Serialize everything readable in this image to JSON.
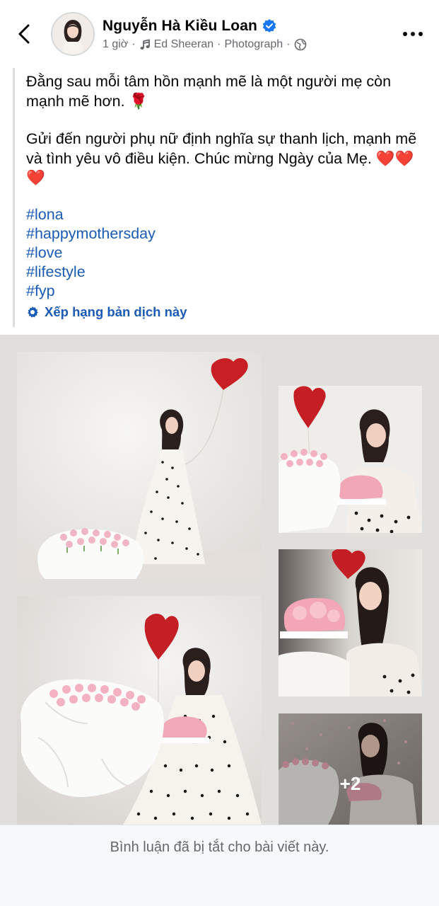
{
  "header": {
    "name": "Nguyễn Hà Kiều Loan",
    "time": "1 giờ",
    "music": "Ed Sheeran",
    "tag": "Photograph",
    "privacy": "Public",
    "icons": {
      "back": "chevron-left-icon",
      "verified": "verified-badge-icon",
      "music": "music-note-icon",
      "privacy": "globe-icon",
      "more": "more-dots-icon"
    },
    "colors": {
      "verified": "#1877f2",
      "meta": "#65676b"
    }
  },
  "post": {
    "line1": "Đằng sau mỗi tâm hồn mạnh mẽ là một người mẹ còn mạnh mẽ hơn. 🌹",
    "line2": "Gửi đến người phụ nữ định nghĩa sự thanh lịch, mạnh mẽ và tình yêu vô điều kiện. Chúc mừng Ngày của Mẹ. ❤️❤️❤️",
    "hashtags": [
      "#lona",
      "#happymothersday",
      "#love",
      "#lifestyle",
      "#fyp"
    ],
    "translate_label": "Xếp hạng bản dịch này",
    "link_color": "#1a5bb5"
  },
  "photos": {
    "more_count": "+2",
    "items": [
      {
        "desc": "Woman in polka-dot dress holding red heart balloon beside tulip bouquet"
      },
      {
        "desc": "Woman seated with pink cake, large white bouquet and heart balloon"
      },
      {
        "desc": "Close-up with pink rose cake and heart balloon"
      },
      {
        "desc": "Smiling woman holding pink rose cake"
      },
      {
        "desc": "Woman with flowers and cake, petals falling"
      }
    ]
  },
  "footer": {
    "comments_disabled": "Bình luận đã bị tắt cho bài viết này."
  }
}
